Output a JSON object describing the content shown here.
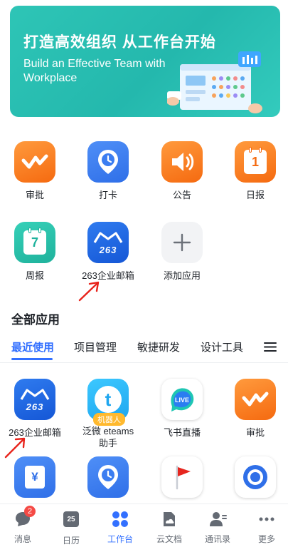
{
  "banner": {
    "title": "打造高效组织 从工作台开始",
    "subtitle": "Build an Effective Team with Workplace"
  },
  "quick_apps": [
    {
      "label": "审批",
      "icon": "approval-check-icon"
    },
    {
      "label": "打卡",
      "icon": "clock-in-pin-icon"
    },
    {
      "label": "公告",
      "icon": "announcement-speaker-icon"
    },
    {
      "label": "日报",
      "icon": "daily-report-calendar-icon"
    },
    {
      "label": "周报",
      "icon": "weekly-report-calendar-icon"
    },
    {
      "label": "263企业邮箱",
      "icon": "263-mail-icon"
    },
    {
      "label": "添加应用",
      "icon": "plus-icon"
    }
  ],
  "calendar_day_daily": "1",
  "calendar_day_weekly": "7",
  "section_title": "全部应用",
  "tabs": [
    {
      "label": "最近使用",
      "active": true
    },
    {
      "label": "项目管理",
      "active": false
    },
    {
      "label": "敏捷研发",
      "active": false
    },
    {
      "label": "设计工具",
      "active": false
    }
  ],
  "recent_apps": [
    {
      "label": "263企业邮箱",
      "icon": "263-mail-icon"
    },
    {
      "label": "泛微 eteams\n助手",
      "label_line1": "泛微 eteams",
      "label_line2": "助手",
      "icon": "eteams-t-icon",
      "badge": "机器人"
    },
    {
      "label": "飞书直播",
      "icon": "live-icon"
    },
    {
      "label": "审批",
      "icon": "approval-check-icon"
    }
  ],
  "more_apps_icons": [
    "yen-icon",
    "clock-in-pin-icon",
    "red-flag-icon",
    "target-ring-icon"
  ],
  "brand_text": "263",
  "live_text": "LIVE",
  "bottom_nav": [
    {
      "label": "消息",
      "icon": "message-icon",
      "badge": "2"
    },
    {
      "label": "日历",
      "icon": "calendar-icon",
      "day": "25"
    },
    {
      "label": "工作台",
      "icon": "workplace-icon",
      "active": true
    },
    {
      "label": "云文档",
      "icon": "cloud-doc-icon"
    },
    {
      "label": "通讯录",
      "icon": "contacts-icon"
    },
    {
      "label": "更多",
      "icon": "more-dots-icon"
    }
  ],
  "colors": {
    "accent": "#3370ff",
    "banner": "#2ec5b6",
    "orange": "#f56a10",
    "annotation_arrow": "#e8231b"
  }
}
